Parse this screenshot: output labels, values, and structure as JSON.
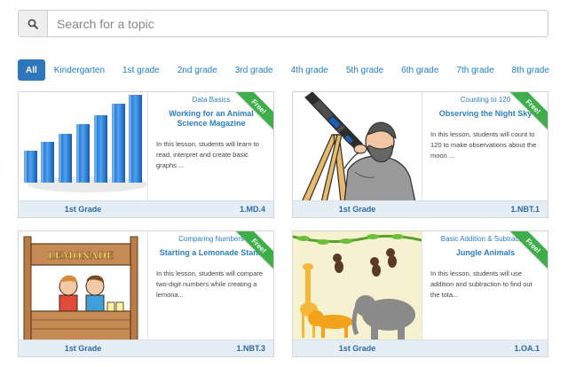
{
  "search": {
    "placeholder": "Search for a topic",
    "icon": "search-icon"
  },
  "grades": [
    {
      "label": "All",
      "active": true
    },
    {
      "label": "Kindergarten"
    },
    {
      "label": "1st grade"
    },
    {
      "label": "2nd grade"
    },
    {
      "label": "3rd grade"
    },
    {
      "label": "4th grade"
    },
    {
      "label": "5th grade"
    },
    {
      "label": "6th grade"
    },
    {
      "label": "7th grade"
    },
    {
      "label": "8th grade"
    }
  ],
  "cards": [
    {
      "badge": "Free!",
      "category": "Data Basics",
      "title": "Working for an Animal Science Magazine",
      "description": "In this lesson, students will learn to read, interpret and create basic graphs ...",
      "grade": "1st Grade",
      "standard": "1.MD.4",
      "image": "bar-graph-illustration"
    },
    {
      "badge": "Free!",
      "category": "Counting to 120",
      "title": "Observing the Night Sky",
      "description": "In this lesson, students will count to 120 to make observations about the moon ...",
      "grade": "1st Grade",
      "standard": "1.NBT.1",
      "image": "telescope-astronomer-illustration"
    },
    {
      "badge": "Free!",
      "category": "Comparing Numbers",
      "title": "Starting a Lemonade Stand",
      "description": "In this lesson, students will compare two-digit numbers while creating a lemona...",
      "grade": "1st Grade",
      "standard": "1.NBT.3",
      "image": "lemonade-stand-illustration",
      "sign_text": "LEMONADE"
    },
    {
      "badge": "Free!",
      "category": "Basic Addition & Subtraction",
      "title": "Jungle Animals",
      "description": "In this lesson, students will use addition and subtraction to find out the tota...",
      "grade": "1st Grade",
      "standard": "1.OA.1",
      "image": "jungle-animals-illustration"
    }
  ],
  "colors": {
    "accent": "#2f77bd",
    "link": "#1f7ec2",
    "ribbon": "#3fae4a",
    "footer": "#e6eef5"
  }
}
